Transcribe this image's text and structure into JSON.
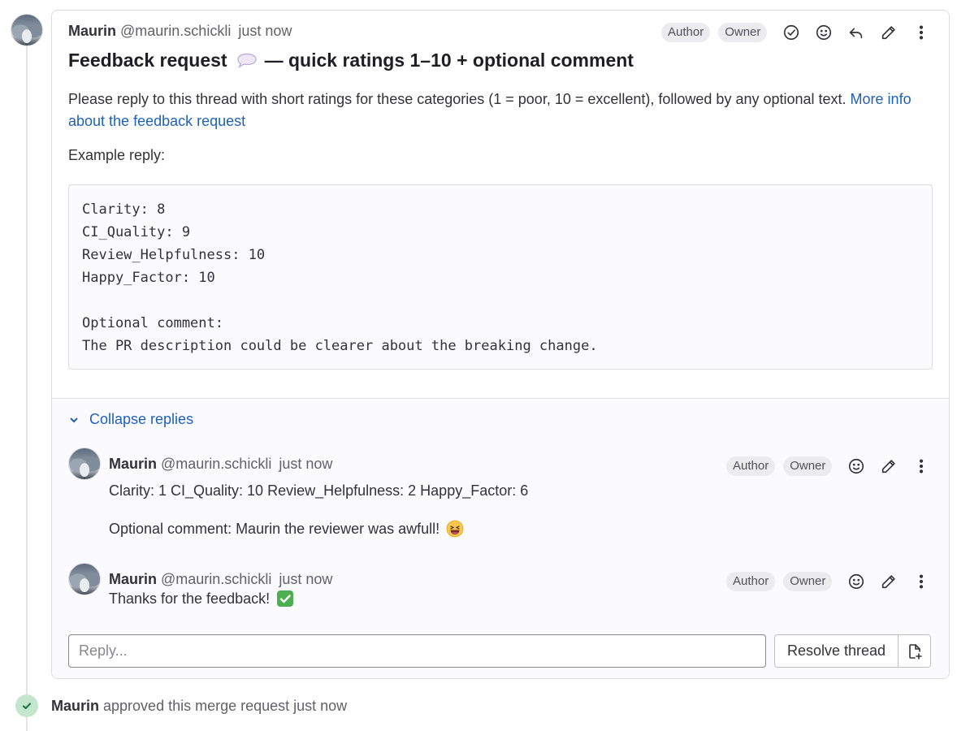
{
  "main_note": {
    "author": "Maurin",
    "handle": "@maurin.schickli",
    "time": "just now",
    "badges": [
      "Author",
      "Owner"
    ],
    "title_prefix": "Feedback request",
    "title_suffix": "— quick ratings 1–10 + optional comment",
    "body_text": "Please reply to this thread with short ratings for these categories (1 = poor, 10 = excellent), followed by any optional text. ",
    "body_link": "More info about the feedback request",
    "example_label": "Example reply:",
    "code": "Clarity: 8\nCI_Quality: 9\nReview_Helpfulness: 10\nHappy_Factor: 10\n\nOptional comment:\nThe PR description could be clearer about the breaking change."
  },
  "replies_section": {
    "collapse_label": "Collapse replies"
  },
  "replies": [
    {
      "author": "Maurin",
      "handle": "@maurin.schickli",
      "time": "just now",
      "badges": [
        "Author",
        "Owner"
      ],
      "line1": "Clarity: 1 CI_Quality: 10 Review_Helpfulness: 2 Happy_Factor: 6",
      "line2": "Optional comment: Maurin the reviewer was awfull!",
      "emoji": "grinning-squinting-face-icon"
    },
    {
      "author": "Maurin",
      "handle": "@maurin.schickli",
      "time": "just now",
      "badges": [
        "Author",
        "Owner"
      ],
      "line1": "Thanks for the feedback!",
      "emoji": "check-mark-button-icon"
    }
  ],
  "reply_box": {
    "placeholder": "Reply...",
    "resolve_label": "Resolve thread"
  },
  "approval": {
    "author": "Maurin",
    "text": "approved this merge request just now"
  },
  "colors": {
    "link": "#1f61b8",
    "badge_bg": "#ececef",
    "approval_green": "#c3e6cd"
  }
}
